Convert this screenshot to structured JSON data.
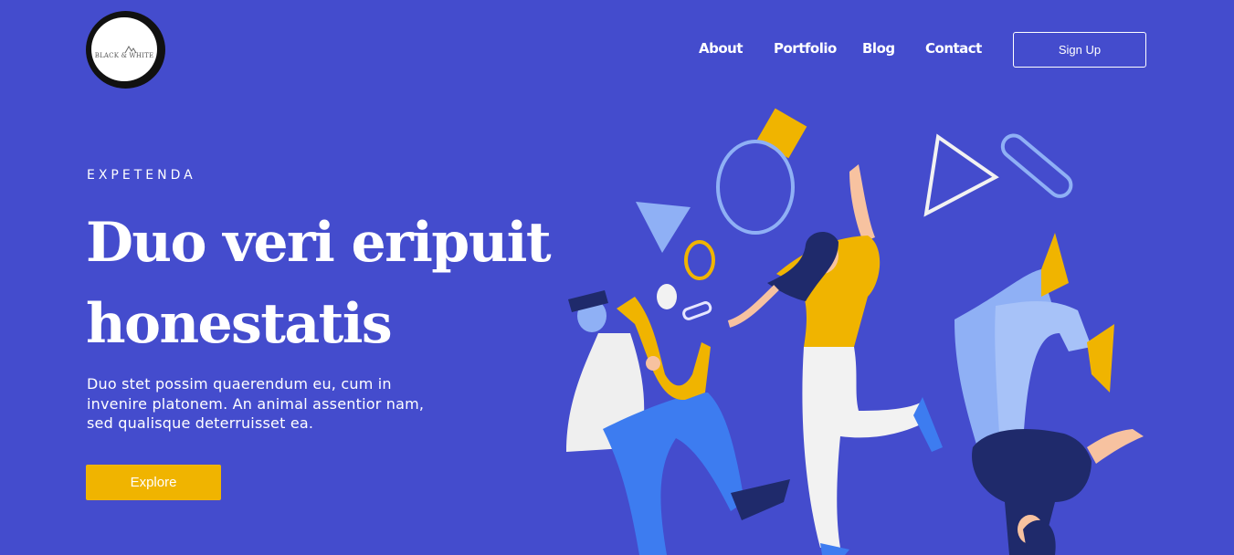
{
  "brand": {
    "logo_text": "BLACK & WHITE",
    "logo_icon": "mountain-icon"
  },
  "nav": {
    "links": [
      "About",
      "Portfolio",
      "Blog",
      "Contact"
    ],
    "signup_label": "Sign Up"
  },
  "hero": {
    "eyebrow": "EXPETENDA",
    "headline_line1": "Duo veri eripuit",
    "headline_line2": "honestatis",
    "body": "Duo stet possim quaerendum eu, cum in invenire platonem. An animal assentior nam, sed qualisque deterruisset ea.",
    "cta_label": "Explore"
  },
  "colors": {
    "background": "#444ccd",
    "accent_yellow": "#f0b400",
    "text": "#ffffff"
  }
}
